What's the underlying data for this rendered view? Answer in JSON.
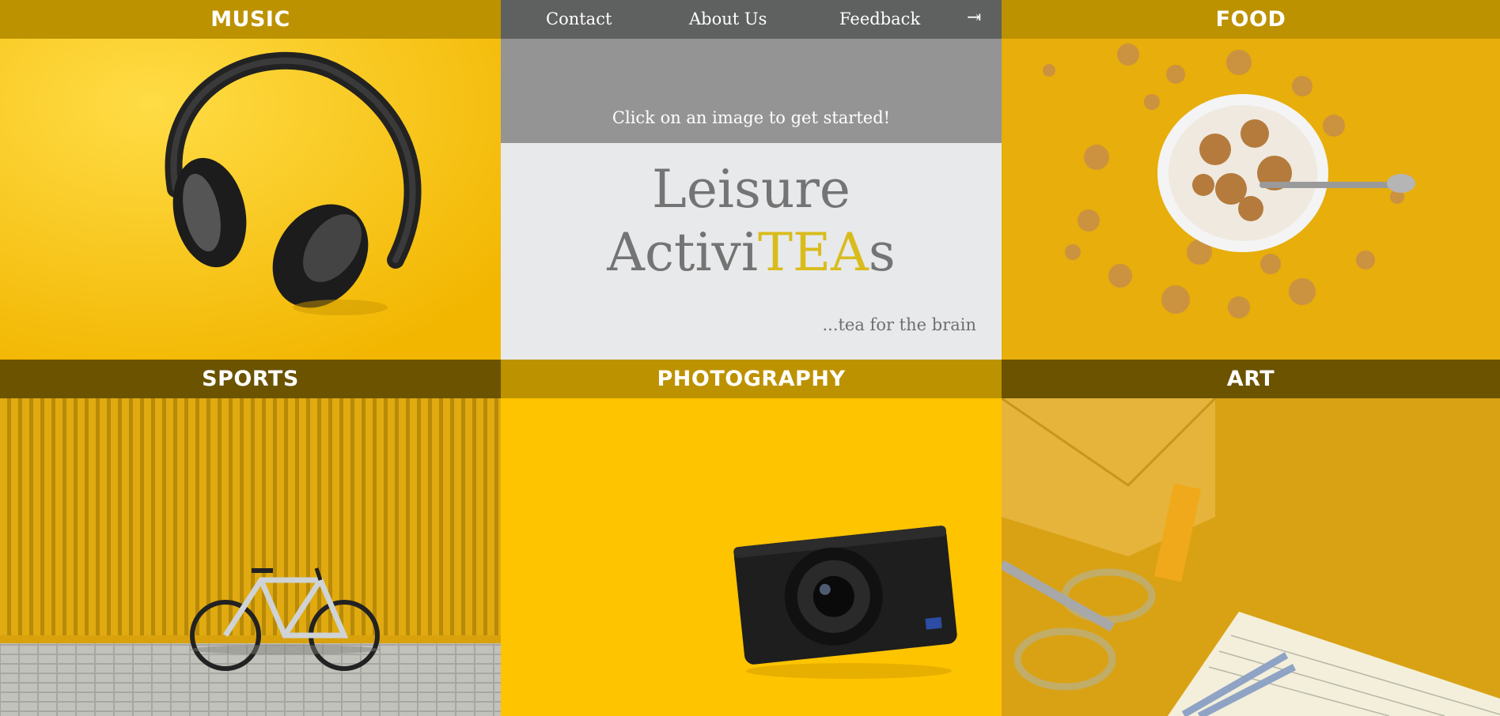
{
  "nav": {
    "contact": "Contact",
    "about": "About Us",
    "feedback": "Feedback",
    "logout_icon": "⇥"
  },
  "banner": {
    "text": "Click on an image to get started!"
  },
  "brand": {
    "line1": "Leisure",
    "line2_prefix": "Activi",
    "line2_accent": "TEA",
    "line2_suffix": "s",
    "tagline": "...tea for the brain"
  },
  "tiles": {
    "music": "MUSIC",
    "food": "FOOD",
    "sports": "SPORTS",
    "photography": "PHOTOGRAPHY",
    "art": "ART"
  },
  "colors": {
    "header_gold": "#bd9200",
    "header_dark": "#6b5300",
    "nav_bg": "#5f6060",
    "banner_bg": "#949494",
    "brand_bg": "#e8e9eb",
    "accent": "#d9bc1c"
  }
}
